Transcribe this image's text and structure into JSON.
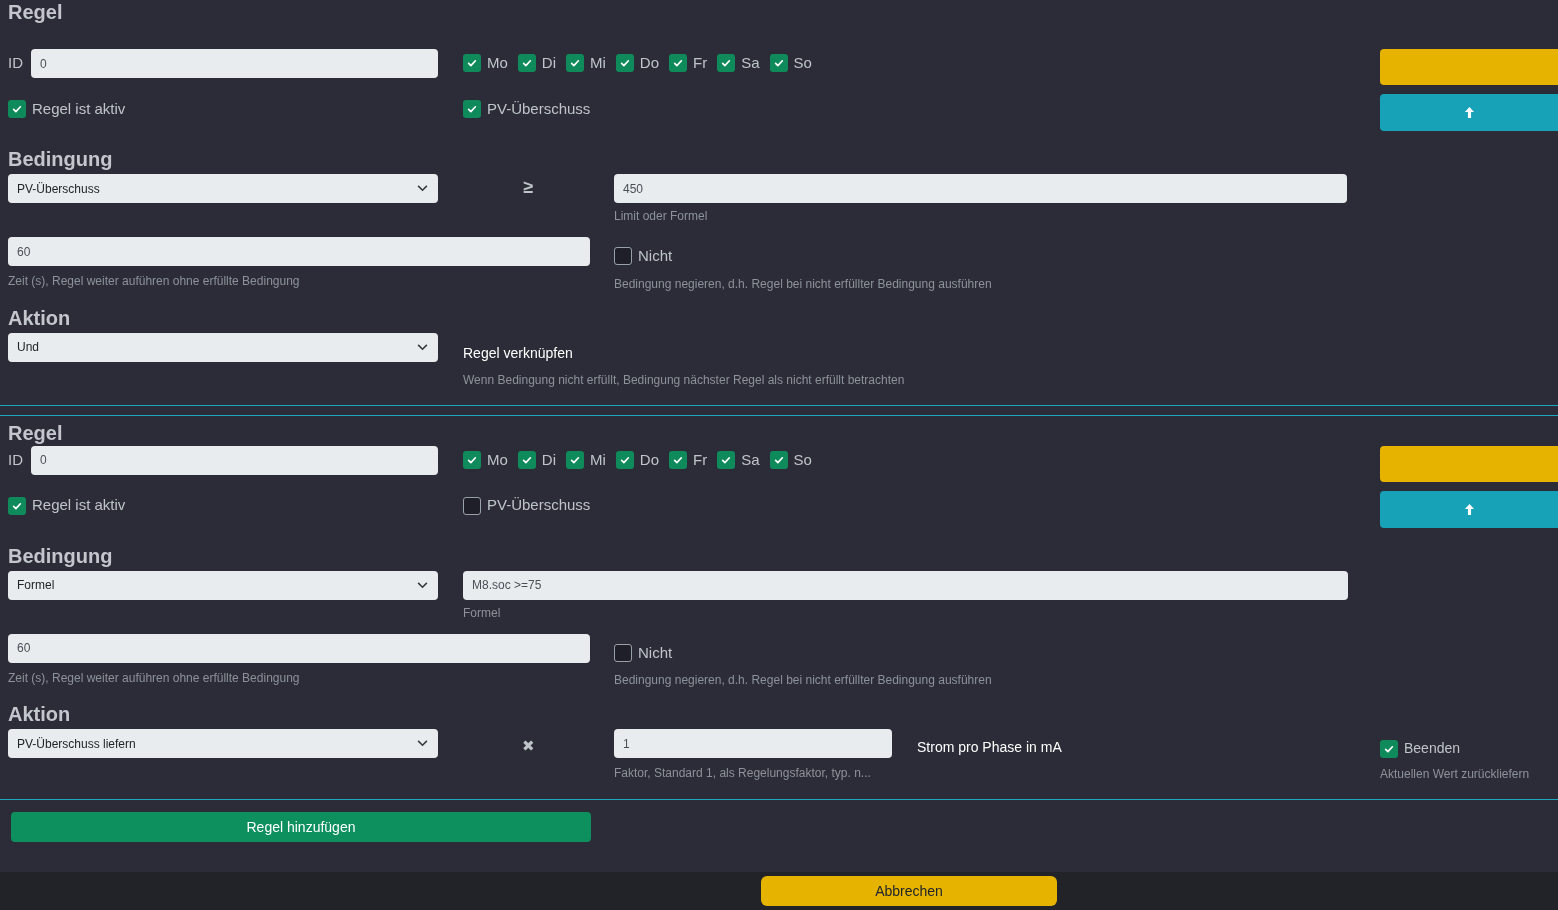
{
  "rules": [
    {
      "title": "Regel",
      "id_label": "ID",
      "id_value": "0",
      "active": {
        "label": "Regel ist aktiv",
        "checked": true
      },
      "days": [
        {
          "label": "Mo",
          "checked": true
        },
        {
          "label": "Di",
          "checked": true
        },
        {
          "label": "Mi",
          "checked": true
        },
        {
          "label": "Do",
          "checked": true
        },
        {
          "label": "Fr",
          "checked": true
        },
        {
          "label": "Sa",
          "checked": true
        },
        {
          "label": "So",
          "checked": true
        }
      ],
      "pv_surplus": {
        "label": "PV-Überschuss",
        "checked": true
      },
      "condition_title": "Bedingung",
      "condition": {
        "kind": "threshold",
        "select": "PV-Überschuss",
        "operator": "≥",
        "value": "450",
        "hint": "Limit oder Formel"
      },
      "time": {
        "value": "60",
        "hint": "Zeit (s), Regel weiter auführen ohne erfüllte Bedingung"
      },
      "negate": {
        "label": "Nicht",
        "checked": false,
        "hint": "Bedingung negieren, d.h. Regel bei nicht erfüllter Bedingung ausführen"
      },
      "action_title": "Aktion",
      "action": {
        "kind": "link",
        "select": "Und",
        "label": "Regel verknüpfen",
        "hint": "Wenn Bedingung nicht erfüllt, Bedingung nächster Regel als nicht erfüllt betrachten"
      }
    },
    {
      "title": "Regel",
      "id_label": "ID",
      "id_value": "0",
      "active": {
        "label": "Regel ist aktiv",
        "checked": true
      },
      "days": [
        {
          "label": "Mo",
          "checked": true
        },
        {
          "label": "Di",
          "checked": true
        },
        {
          "label": "Mi",
          "checked": true
        },
        {
          "label": "Do",
          "checked": true
        },
        {
          "label": "Fr",
          "checked": true
        },
        {
          "label": "Sa",
          "checked": true
        },
        {
          "label": "So",
          "checked": true
        }
      ],
      "pv_surplus": {
        "label": "PV-Überschuss",
        "checked": false
      },
      "condition_title": "Bedingung",
      "condition": {
        "kind": "formula",
        "select": "Formel",
        "value": "M8.soc >=75",
        "hint": "Formel"
      },
      "time": {
        "value": "60",
        "hint": "Zeit (s), Regel weiter auführen ohne erfüllte Bedingung"
      },
      "negate": {
        "label": "Nicht",
        "checked": false,
        "hint": "Bedingung negieren, d.h. Regel bei nicht erfüllter Bedingung ausführen"
      },
      "action_title": "Aktion",
      "action": {
        "kind": "deliver",
        "select": "PV-Überschuss liefern",
        "operator": "✖",
        "value": "1",
        "hint": "Faktor, Standard 1, als Regelungsfaktor, typ. n...",
        "label": "Strom pro Phase in mA",
        "finish": {
          "label": "Beenden",
          "checked": true,
          "hint": "Aktuellen Wert zurückliefern"
        }
      }
    }
  ],
  "add_button": "Regel hinzufügen",
  "footer": {
    "cancel_button": "Abbrechen"
  }
}
